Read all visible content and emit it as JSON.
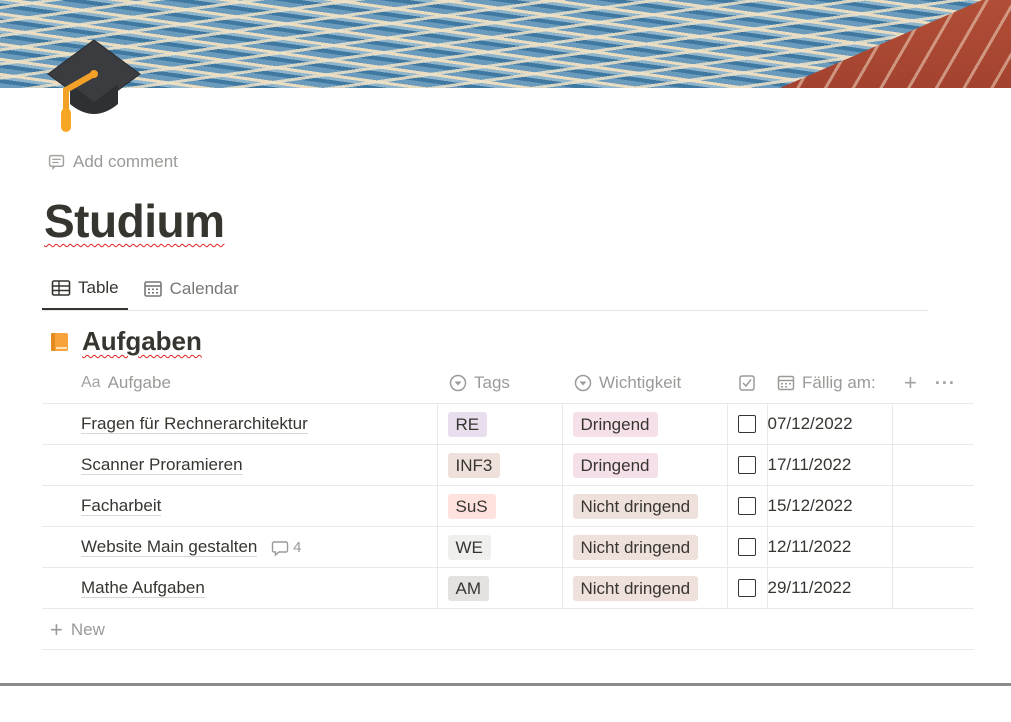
{
  "page": {
    "icon": "graduation-cap-icon",
    "add_comment_label": "Add comment",
    "title": "Studium"
  },
  "views": [
    {
      "label": "Table",
      "icon": "table-icon",
      "active": true
    },
    {
      "label": "Calendar",
      "icon": "calendar-icon",
      "active": false
    }
  ],
  "database": {
    "icon": "orange-book-icon",
    "title": "Aufgaben",
    "columns": {
      "aufgabe": {
        "label": "Aufgabe",
        "icon": "Aa"
      },
      "tags": {
        "label": "Tags",
        "icon": "select-icon"
      },
      "wichtigkeit": {
        "label": "Wichtigkeit",
        "icon": "select-icon"
      },
      "done": {
        "label": "",
        "icon": "checkbox-icon"
      },
      "faellig": {
        "label": "Fällig am:",
        "icon": "date-icon"
      }
    },
    "rows": [
      {
        "name": "Fragen für Rechnerarchitektur",
        "tag": "RE",
        "wichtigkeit": "Dringend",
        "done": false,
        "date": "07/12/2022",
        "comments": ""
      },
      {
        "name": "Scanner Proramieren",
        "tag": "INF3",
        "wichtigkeit": "Dringend",
        "done": false,
        "date": "17/11/2022",
        "comments": ""
      },
      {
        "name": "Facharbeit",
        "tag": "SuS",
        "wichtigkeit": "Nicht dringend",
        "done": false,
        "date": "15/12/2022",
        "comments": ""
      },
      {
        "name": "Website Main gestalten",
        "tag": "WE",
        "wichtigkeit": "Nicht dringend",
        "done": false,
        "date": "12/11/2022",
        "comments": "4"
      },
      {
        "name": "Mathe Aufgaben",
        "tag": "AM",
        "wichtigkeit": "Nicht dringend",
        "done": false,
        "date": "29/11/2022",
        "comments": ""
      }
    ],
    "new_label": "New"
  }
}
